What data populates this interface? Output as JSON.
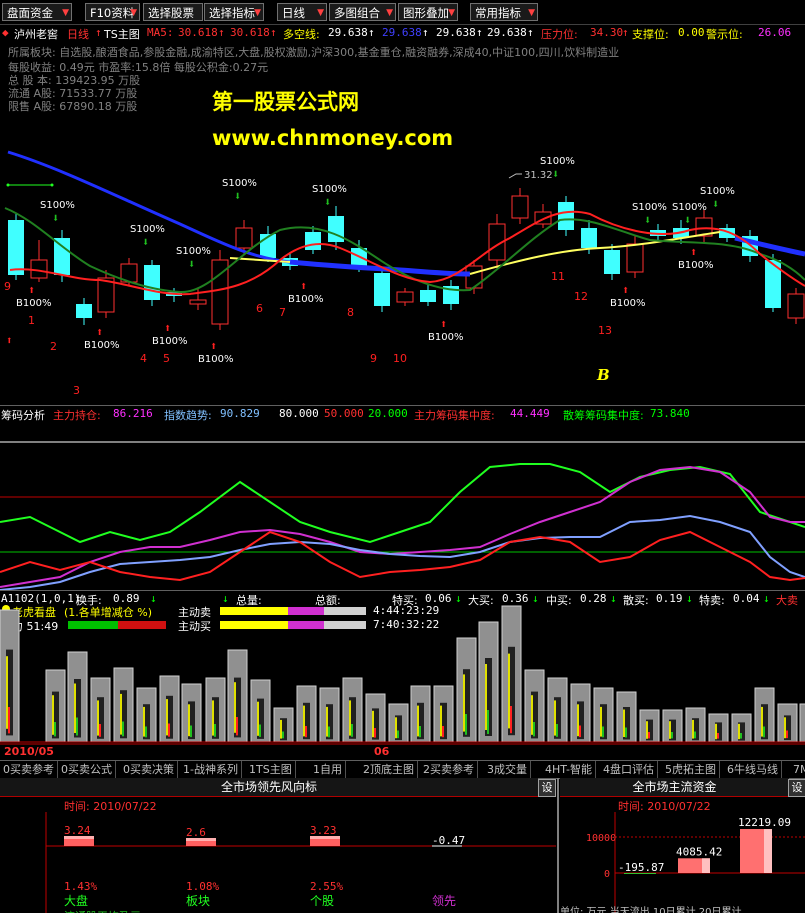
{
  "toolbar": {
    "buttons": [
      "盘面资金",
      "F10资料",
      "选择股票",
      "选择指标",
      "日线",
      "多图组合",
      "图形叠加",
      "常用指标"
    ]
  },
  "kline": {
    "stock": "泸州老窖",
    "period": "日线",
    "main_indicator": "TS主图",
    "ma5_label": "MA5:",
    "ma5_a": "30.618",
    "ma5_b": "30.618",
    "duokong_label": "多空线:",
    "duokong_a": "29.638",
    "duokong_b": "29.638",
    "duokong_c": "29.638",
    "duokong_d": "29.638",
    "pressure_label": "压力位:",
    "pressure": "34.30",
    "support_label": "支撑位:",
    "support": "0.00",
    "warn_label": "警示位:",
    "warn": "26.06",
    "info": [
      "所属板块: 自选股,酿酒食品,参股金融,成渝特区,大盘,股权激励,沪深300,基金重仓,融资融券,深成40,中证100,四川,饮料制造业",
      "每股收益: 0.49元    市盈率:15.8倍    每股公积金:0.27元",
      "总 股 本: 139423.95  万股",
      "流通 A股: 71533.77  万股",
      "限售 A股: 67890.18  万股"
    ],
    "watermark_title": "第一股票公式网",
    "watermark_url": "www.chnmoney.com",
    "peak_label": "31.32",
    "signal_s": "S100%",
    "signal_b": "B100%",
    "letter_b": "B",
    "wave_numbers": [
      "1",
      "2",
      "3",
      "4",
      "5",
      "6",
      "7",
      "8",
      "9",
      "10",
      "11",
      "12",
      "13",
      "9"
    ]
  },
  "chip": {
    "title": "筹码分析",
    "main_hold_label": "主力持仓:",
    "main_hold": "86.216",
    "trend_label": "指数趋势:",
    "trend": "90.829",
    "v1": "80.000",
    "v2": "50.000",
    "v3": "20.000",
    "main_conc_label": "主力筹码集中度:",
    "main_conc": "44.449",
    "retail_conc_label": "散筹筹码集中度:",
    "retail_conc": "73.840"
  },
  "vol": {
    "row1": {
      "code": "A1102(1,0,1)",
      "turnover_label": "换手:",
      "turnover": "0.89",
      "total_vol_label": "总量:",
      "total_amt_label": "总额:",
      "special_buy_label": "特买:",
      "special_buy": "0.06",
      "big_buy_label": "大买:",
      "big_buy": "0.36",
      "mid_buy_label": "中买:",
      "mid_buy": "0.28",
      "retail_buy_label": "散买:",
      "retail_buy": "0.19",
      "special_sell_label": "特卖:",
      "special_sell": "0.04",
      "big_sell_label": "大卖"
    },
    "row2": {
      "title": "老虎看盘",
      "note": "(1.各单增减仓 %)",
      "active_sell_label": "主动卖",
      "active_sell": "4:44:23:29"
    },
    "row3": {
      "main_label": "主力 51:49",
      "active_buy_label": "主动买",
      "active_buy": "7:40:32:22"
    },
    "date_left": "2010/05",
    "date_right": "06"
  },
  "tabs": [
    "0买卖参考",
    "0买卖公式",
    "0买卖决策",
    "1-战神系列",
    "1TS主图",
    "1自用",
    "2顶底主图",
    "2买卖参考",
    "3成交量",
    "4HT-智能",
    "4盘口评估",
    "5虎拓主图",
    "6牛线马线",
    "7M"
  ],
  "left_panel": {
    "title": "全市场领先风向标",
    "set": "设",
    "time_label": "时间:",
    "time": "2010/07/22",
    "bars": [
      {
        "value": "3.24",
        "pct": "1.43%",
        "name": "大盘"
      },
      {
        "value": "2.6",
        "pct": "1.08%",
        "name": "板块"
      },
      {
        "value": "3.23",
        "pct": "2.55%",
        "name": "个股"
      },
      {
        "value": "-0.47",
        "pct": "",
        "name": "领先"
      }
    ],
    "bottom_text": "流通股平均盈亏"
  },
  "right_panel": {
    "title": "全市场主流资金",
    "set": "设",
    "time_label": "时间:",
    "time": "2010/07/22",
    "axis": [
      "10000",
      "0"
    ],
    "bars": [
      {
        "value": "-195.87"
      },
      {
        "value": "4085.42"
      },
      {
        "value": "12219.09"
      }
    ],
    "bottom_text": "单位: 万元   当天流出   10日累计   20日累计"
  }
}
